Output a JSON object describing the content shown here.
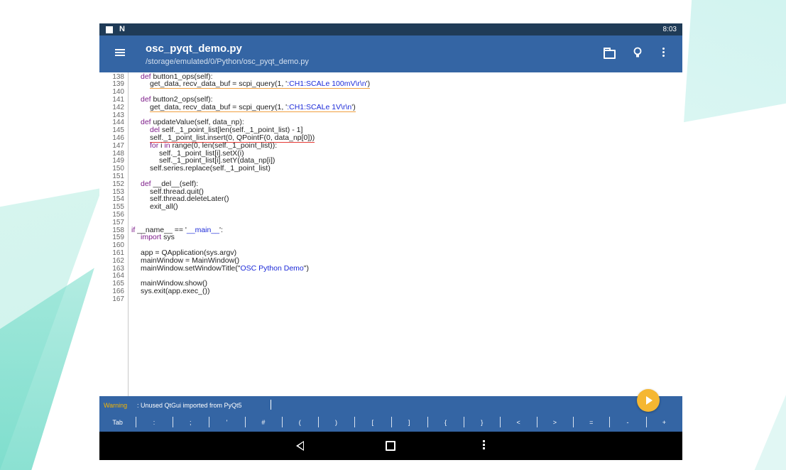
{
  "status_bar": {
    "notification_letter": "N",
    "time": "8:03"
  },
  "app_bar": {
    "title": "osc_pyqt_demo.py",
    "path": "/storage/emulated/0/Python/osc_pyqt_demo.py",
    "icons": [
      "menu-icon",
      "folder-icon",
      "lightbulb-icon",
      "more-vert-icon"
    ]
  },
  "editor": {
    "lines": [
      {
        "n": "138",
        "indent": 1,
        "parts": [
          [
            "kw",
            "def"
          ],
          [
            "",
            " button1_ops(self):"
          ]
        ]
      },
      {
        "n": "139",
        "indent": 2,
        "parts": [
          [
            "sq",
            "get_data, recv_data_buf = scpi_query(1, '"
          ],
          [
            "sqs",
            ":CH1:SCALe 100mV\\r\\n"
          ],
          [
            "sq",
            "')"
          ]
        ]
      },
      {
        "n": "140",
        "indent": 0,
        "parts": []
      },
      {
        "n": "141",
        "indent": 1,
        "parts": [
          [
            "kw",
            "def"
          ],
          [
            "",
            " button2_ops(self):"
          ]
        ]
      },
      {
        "n": "142",
        "indent": 2,
        "parts": [
          [
            "sq",
            "get_data, recv_data_buf = scpi_query(1, '"
          ],
          [
            "sqs",
            ":CH1:SCALe 1V\\r\\n"
          ],
          [
            "sq",
            "')"
          ]
        ]
      },
      {
        "n": "143",
        "indent": 0,
        "parts": []
      },
      {
        "n": "144",
        "indent": 1,
        "parts": [
          [
            "kw",
            "def"
          ],
          [
            "",
            " updateValue(self, data_np):"
          ]
        ]
      },
      {
        "n": "145",
        "indent": 2,
        "parts": [
          [
            "kw",
            "del"
          ],
          [
            "",
            " self._1_point_list[len(self._1_point_list) - 1]"
          ]
        ]
      },
      {
        "n": "146",
        "indent": 2,
        "parts": [
          [
            "sqr",
            "self._1_point_list.insert(0, QPointF(0, data_np[0]))"
          ]
        ]
      },
      {
        "n": "147",
        "indent": 2,
        "parts": [
          [
            "kw",
            "for"
          ],
          [
            "",
            " i "
          ],
          [
            "kw",
            "in"
          ],
          [
            "",
            " range(0, len(self._1_point_list)):"
          ]
        ]
      },
      {
        "n": "148",
        "indent": 3,
        "parts": [
          [
            "",
            "self._1_point_list[i].setX(i)"
          ]
        ]
      },
      {
        "n": "149",
        "indent": 3,
        "parts": [
          [
            "",
            "self._1_point_list[i].setY(data_np[i])"
          ]
        ]
      },
      {
        "n": "150",
        "indent": 2,
        "parts": [
          [
            "",
            "self.series.replace(self._1_point_list)"
          ]
        ]
      },
      {
        "n": "151",
        "indent": 0,
        "parts": []
      },
      {
        "n": "152",
        "indent": 1,
        "parts": [
          [
            "kw",
            "def"
          ],
          [
            "",
            " __del__(self):"
          ]
        ]
      },
      {
        "n": "153",
        "indent": 2,
        "parts": [
          [
            "",
            "self.thread.quit()"
          ]
        ]
      },
      {
        "n": "154",
        "indent": 2,
        "parts": [
          [
            "",
            "self.thread.deleteLater()"
          ]
        ]
      },
      {
        "n": "155",
        "indent": 2,
        "parts": [
          [
            "",
            "exit_all()"
          ]
        ]
      },
      {
        "n": "156",
        "indent": 0,
        "parts": []
      },
      {
        "n": "157",
        "indent": 0,
        "parts": []
      },
      {
        "n": "158",
        "indent": 0,
        "parts": [
          [
            "kw",
            "if"
          ],
          [
            "",
            " __name__ == '"
          ],
          [
            "str",
            "__main__"
          ],
          [
            "",
            "':"
          ]
        ]
      },
      {
        "n": "159",
        "indent": 1,
        "parts": [
          [
            "kw",
            "import"
          ],
          [
            "",
            " sys"
          ]
        ]
      },
      {
        "n": "160",
        "indent": 0,
        "parts": []
      },
      {
        "n": "161",
        "indent": 1,
        "parts": [
          [
            "",
            "app = QApplication(sys.argv)"
          ]
        ]
      },
      {
        "n": "162",
        "indent": 1,
        "parts": [
          [
            "",
            "mainWindow = MainWindow()"
          ]
        ]
      },
      {
        "n": "163",
        "indent": 1,
        "parts": [
          [
            "",
            "mainWindow.setWindowTitle(\""
          ],
          [
            "str",
            "OSC Python Demo"
          ],
          [
            "",
            "\")"
          ]
        ]
      },
      {
        "n": "164",
        "indent": 0,
        "parts": []
      },
      {
        "n": "165",
        "indent": 1,
        "parts": [
          [
            "",
            "mainWindow.show()"
          ]
        ]
      },
      {
        "n": "166",
        "indent": 1,
        "parts": [
          [
            "",
            "sys.exit(app.exec_())"
          ]
        ]
      },
      {
        "n": "167",
        "indent": 0,
        "parts": []
      }
    ]
  },
  "warning": {
    "label": "Warning",
    "message": ": Unused QtGui imported from PyQt5"
  },
  "key_bar": [
    "Tab",
    ":",
    ";",
    "'",
    "#",
    "(",
    ")",
    "[",
    "]",
    "{",
    "}",
    "<",
    ">",
    "=",
    "-",
    "+"
  ],
  "fab": {
    "icon": "play-icon",
    "color": "#f5b731"
  },
  "nav_bar": {
    "icons": [
      "back-icon",
      "home-icon",
      "menu-icon"
    ]
  },
  "colors": {
    "status_bar": "#1f3b57",
    "app_bar": "#3465a4",
    "keyword": "#7d1d8a",
    "string": "#1c2ad8"
  }
}
